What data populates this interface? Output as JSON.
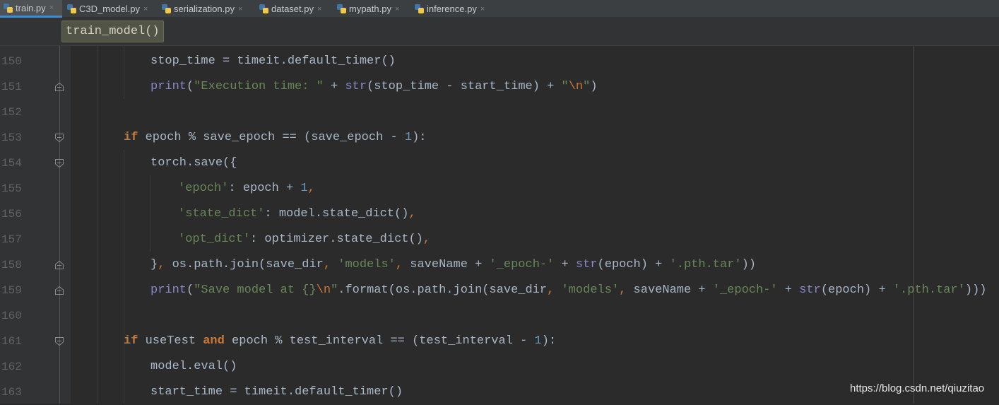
{
  "tabs": [
    {
      "label": "train.py",
      "active": true,
      "icon": "python-file-icon"
    },
    {
      "label": "C3D_model.py",
      "active": false,
      "icon": "python-file-icon"
    },
    {
      "label": "serialization.py",
      "active": false,
      "icon": "python-file-icon"
    },
    {
      "label": "dataset.py",
      "active": false,
      "icon": "python-file-icon"
    },
    {
      "label": "mypath.py",
      "active": false,
      "icon": "python-file-icon"
    },
    {
      "label": "inference.py",
      "active": false,
      "icon": "python-file-icon"
    }
  ],
  "tab_close_glyph": "×",
  "breadcrumb": "train_model()",
  "code_lines": [
    {
      "line": "150",
      "fold": "none",
      "tokens": [
        [
          "t",
          "stop_time = timeit.default_timer()"
        ]
      ]
    },
    {
      "line": "151",
      "fold": "end",
      "tokens": [
        [
          "bi",
          "print"
        ],
        [
          "t",
          "("
        ],
        [
          "str",
          "\"Execution time: \""
        ],
        [
          "t",
          " + "
        ],
        [
          "bi",
          "str"
        ],
        [
          "t",
          "(stop_time - start_time) + "
        ],
        [
          "str",
          "\""
        ],
        [
          "esc",
          "\\n"
        ],
        [
          "str",
          "\""
        ],
        [
          "t",
          ")"
        ]
      ]
    },
    {
      "line": "152",
      "fold": "none",
      "tokens": []
    },
    {
      "line": "153",
      "fold": "start",
      "tokens": [
        [
          "kw",
          "if"
        ],
        [
          "t",
          " epoch % save_epoch == (save_epoch - "
        ],
        [
          "num",
          "1"
        ],
        [
          "t",
          "):"
        ]
      ]
    },
    {
      "line": "154",
      "fold": "start",
      "tokens": [
        [
          "t",
          "torch.save({"
        ]
      ]
    },
    {
      "line": "155",
      "fold": "none",
      "tokens": [
        [
          "str",
          "'epoch'"
        ],
        [
          "t",
          ": epoch + "
        ],
        [
          "num",
          "1"
        ],
        [
          "pn",
          ","
        ]
      ]
    },
    {
      "line": "156",
      "fold": "none",
      "tokens": [
        [
          "str",
          "'state_dict'"
        ],
        [
          "t",
          ": model.state_dict()"
        ],
        [
          "pn",
          ","
        ]
      ]
    },
    {
      "line": "157",
      "fold": "none",
      "tokens": [
        [
          "str",
          "'opt_dict'"
        ],
        [
          "t",
          ": optimizer.state_dict()"
        ],
        [
          "pn",
          ","
        ]
      ]
    },
    {
      "line": "158",
      "fold": "end",
      "tokens": [
        [
          "t",
          "}"
        ],
        [
          "pn",
          ","
        ],
        [
          "t",
          " os.path.join(save_dir"
        ],
        [
          "pn",
          ","
        ],
        [
          "t",
          " "
        ],
        [
          "str",
          "'models'"
        ],
        [
          "pn",
          ","
        ],
        [
          "t",
          " saveName + "
        ],
        [
          "str",
          "'_epoch-'"
        ],
        [
          "t",
          " + "
        ],
        [
          "bi",
          "str"
        ],
        [
          "t",
          "(epoch) + "
        ],
        [
          "str",
          "'.pth.tar'"
        ],
        [
          "t",
          "))"
        ]
      ]
    },
    {
      "line": "159",
      "fold": "end",
      "tokens": [
        [
          "bi",
          "print"
        ],
        [
          "t",
          "("
        ],
        [
          "str",
          "\"Save model at {}"
        ],
        [
          "esc",
          "\\n"
        ],
        [
          "str",
          "\""
        ],
        [
          "t",
          ".format(os.path.join(save_dir"
        ],
        [
          "pn",
          ","
        ],
        [
          "t",
          " "
        ],
        [
          "str",
          "'models'"
        ],
        [
          "pn",
          ","
        ],
        [
          "t",
          " saveName + "
        ],
        [
          "str",
          "'_epoch-'"
        ],
        [
          "t",
          " + "
        ],
        [
          "bi",
          "str"
        ],
        [
          "t",
          "(epoch) + "
        ],
        [
          "str",
          "'.pth.tar'"
        ],
        [
          "t",
          ")))"
        ]
      ]
    },
    {
      "line": "160",
      "fold": "none",
      "tokens": []
    },
    {
      "line": "161",
      "fold": "start",
      "tokens": [
        [
          "kw",
          "if"
        ],
        [
          "t",
          " useTest "
        ],
        [
          "kw",
          "and"
        ],
        [
          "t",
          " epoch % test_interval == (test_interval - "
        ],
        [
          "num",
          "1"
        ],
        [
          "t",
          "):"
        ]
      ]
    },
    {
      "line": "162",
      "fold": "none",
      "tokens": [
        [
          "t",
          "model.eval()"
        ]
      ]
    },
    {
      "line": "163",
      "fold": "none",
      "tokens": [
        [
          "t",
          "start_time = timeit.default_timer()"
        ]
      ]
    }
  ],
  "watermark": "https://blog.csdn.net/qiuzitao",
  "colors": {
    "background": "#2b2b2b",
    "gutter": "#313335",
    "keyword": "#cc7832",
    "string": "#6a8759",
    "number": "#6897bb",
    "builtin": "#8888c6",
    "default": "#a9b7c6",
    "line_number": "#606366",
    "active_tab_underline": "#4a88c7"
  }
}
